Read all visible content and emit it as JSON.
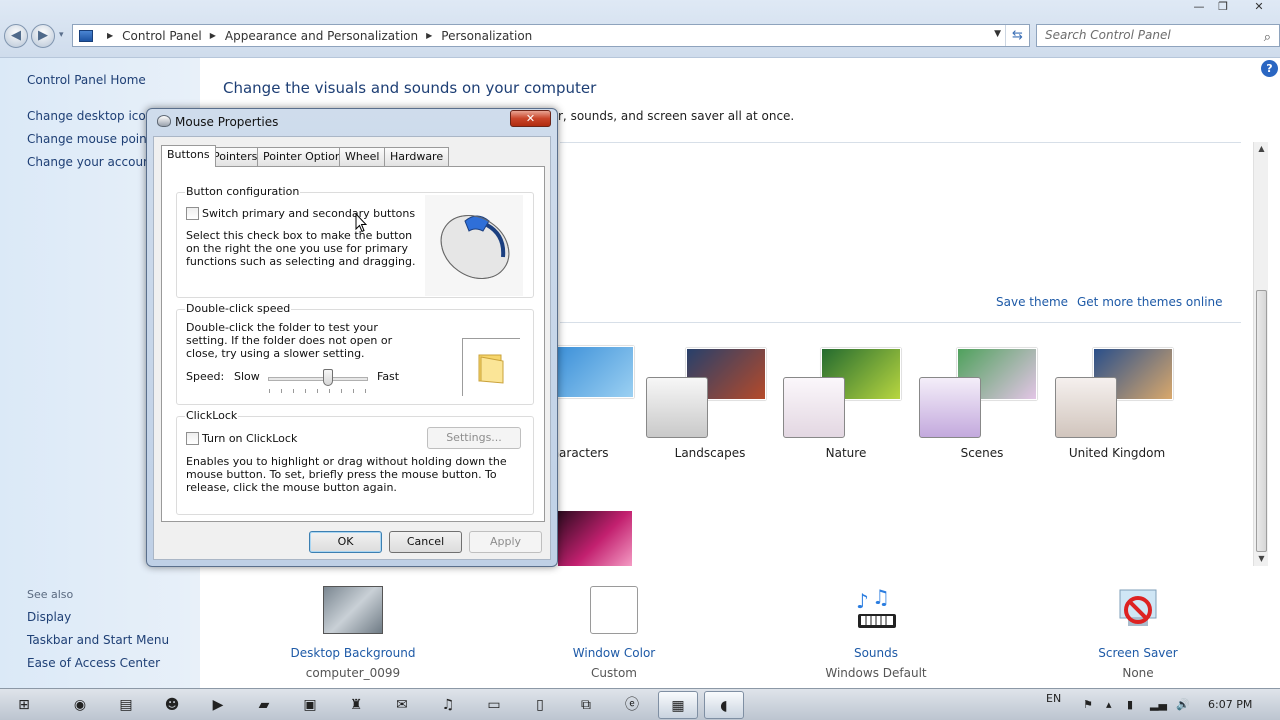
{
  "window": {
    "controls": {
      "minimize": "—",
      "maximize": "❐",
      "close": "✕"
    },
    "back_icon": "◀",
    "forward_icon": "▶",
    "history_icon": "▾"
  },
  "address": {
    "crumbs": [
      "Control Panel",
      "Appearance and Personalization",
      "Personalization"
    ],
    "search_placeholder": "Search Control Panel"
  },
  "left_pane": {
    "home": "Control Panel Home",
    "links": [
      "Change desktop icons",
      "Change mouse pointers",
      "Change your account picture"
    ],
    "see_also_title": "See also",
    "see_also": [
      "Display",
      "Taskbar and Start Menu",
      "Ease of Access Center"
    ]
  },
  "main": {
    "title": "Change the visuals and sounds on your computer",
    "description": "r, sounds, and screen saver all at once.",
    "save_theme": "Save theme",
    "get_more": "Get more themes online",
    "themes": [
      {
        "name": "haracters",
        "colors": [
          "#3b8fd8",
          "#9bd0f2"
        ]
      },
      {
        "name": "Landscapes",
        "colors": [
          "#27406b",
          "#b54a2a"
        ]
      },
      {
        "name": "Nature",
        "colors": [
          "#246b2f",
          "#b8d640"
        ]
      },
      {
        "name": "Scenes",
        "colors": [
          "#4fa15c",
          "#e3c5e6"
        ]
      },
      {
        "name": "United Kingdom",
        "colors": [
          "#2a4f8a",
          "#d9a86c"
        ]
      }
    ]
  },
  "bottom": [
    {
      "name": "Desktop Background",
      "value": "computer_0099"
    },
    {
      "name": "Window Color",
      "value": "Custom"
    },
    {
      "name": "Sounds",
      "value": "Windows Default"
    },
    {
      "name": "Screen Saver",
      "value": "None"
    }
  ],
  "dialog": {
    "title": "Mouse Properties",
    "close": "✕",
    "tabs": [
      "Buttons",
      "Pointers",
      "Pointer Options",
      "Wheel",
      "Hardware"
    ],
    "button_config": {
      "label": "Button configuration",
      "checkbox": "Switch primary and secondary buttons",
      "desc": "Select this check box to make the button on the right the one you use for primary functions such as selecting and dragging."
    },
    "double_click": {
      "label": "Double-click speed",
      "desc": "Double-click the folder to test your setting. If the folder does not open or close, try using a slower setting.",
      "speed": "Speed:",
      "slow": "Slow",
      "fast": "Fast"
    },
    "clicklock": {
      "label": "ClickLock",
      "checkbox": "Turn on ClickLock",
      "settings": "Settings...",
      "desc": "Enables you to highlight or drag without holding down the mouse button. To set, briefly press the mouse button. To release, click the mouse button again."
    },
    "buttons": {
      "ok": "OK",
      "cancel": "Cancel",
      "apply": "Apply"
    }
  },
  "taskbar": {
    "icons": [
      "start-orb",
      "media",
      "folder",
      "people",
      "play",
      "clapper",
      "camera",
      "joystick",
      "mail",
      "music",
      "window",
      "document",
      "windows",
      "app",
      "control-panel",
      "mouse"
    ],
    "lang": "EN",
    "time": "6:07 PM"
  }
}
